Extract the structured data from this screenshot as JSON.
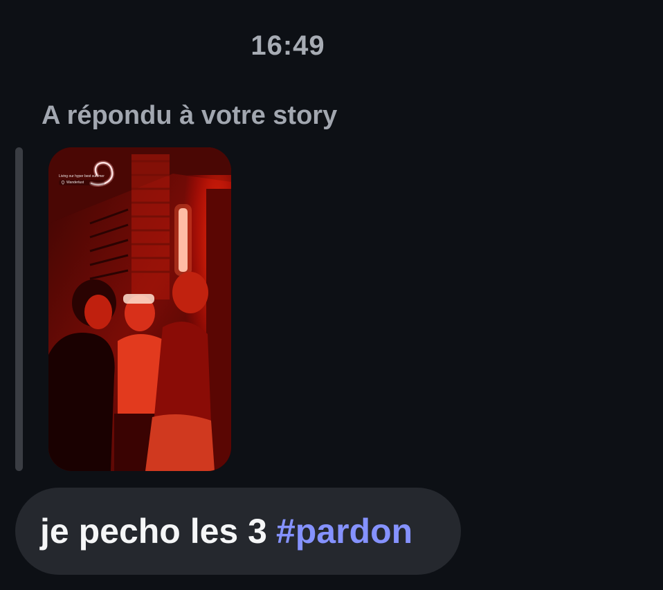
{
  "conversation": {
    "timestamp": "16:49",
    "story_reply": {
      "caption": "A répondu à votre story",
      "story_thumbnail": {
        "overlay_text": "Living our hyper best summer",
        "location_text": "Wanderlust",
        "tone_color": "#ff1a1a"
      }
    },
    "message": {
      "text": "je pecho les 3",
      "hashtag": "#pardon",
      "hashtag_color": "#8592ff",
      "bubble_color": "#25282e"
    }
  }
}
